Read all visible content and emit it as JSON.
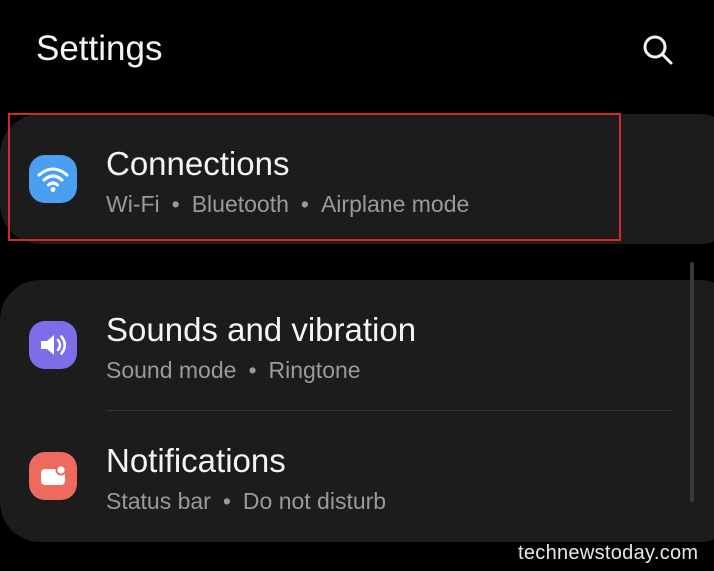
{
  "header": {
    "title": "Settings",
    "search_icon": "search-icon"
  },
  "settings": {
    "connections": {
      "title": "Connections",
      "icon": "wifi-icon",
      "icon_color": "#4a9ff0",
      "subtitle_parts": [
        "Wi-Fi",
        "Bluetooth",
        "Airplane mode"
      ],
      "highlighted": true
    },
    "sounds": {
      "title": "Sounds and vibration",
      "icon": "speaker-icon",
      "icon_color": "#7b6ee8",
      "subtitle_parts": [
        "Sound mode",
        "Ringtone"
      ]
    },
    "notifications": {
      "title": "Notifications",
      "icon": "notification-icon",
      "icon_color": "#ef6a5e",
      "subtitle_parts": [
        "Status bar",
        "Do not disturb"
      ]
    }
  },
  "separator": "•",
  "highlight_color": "#d8262b",
  "watermark": "technewstoday.com"
}
